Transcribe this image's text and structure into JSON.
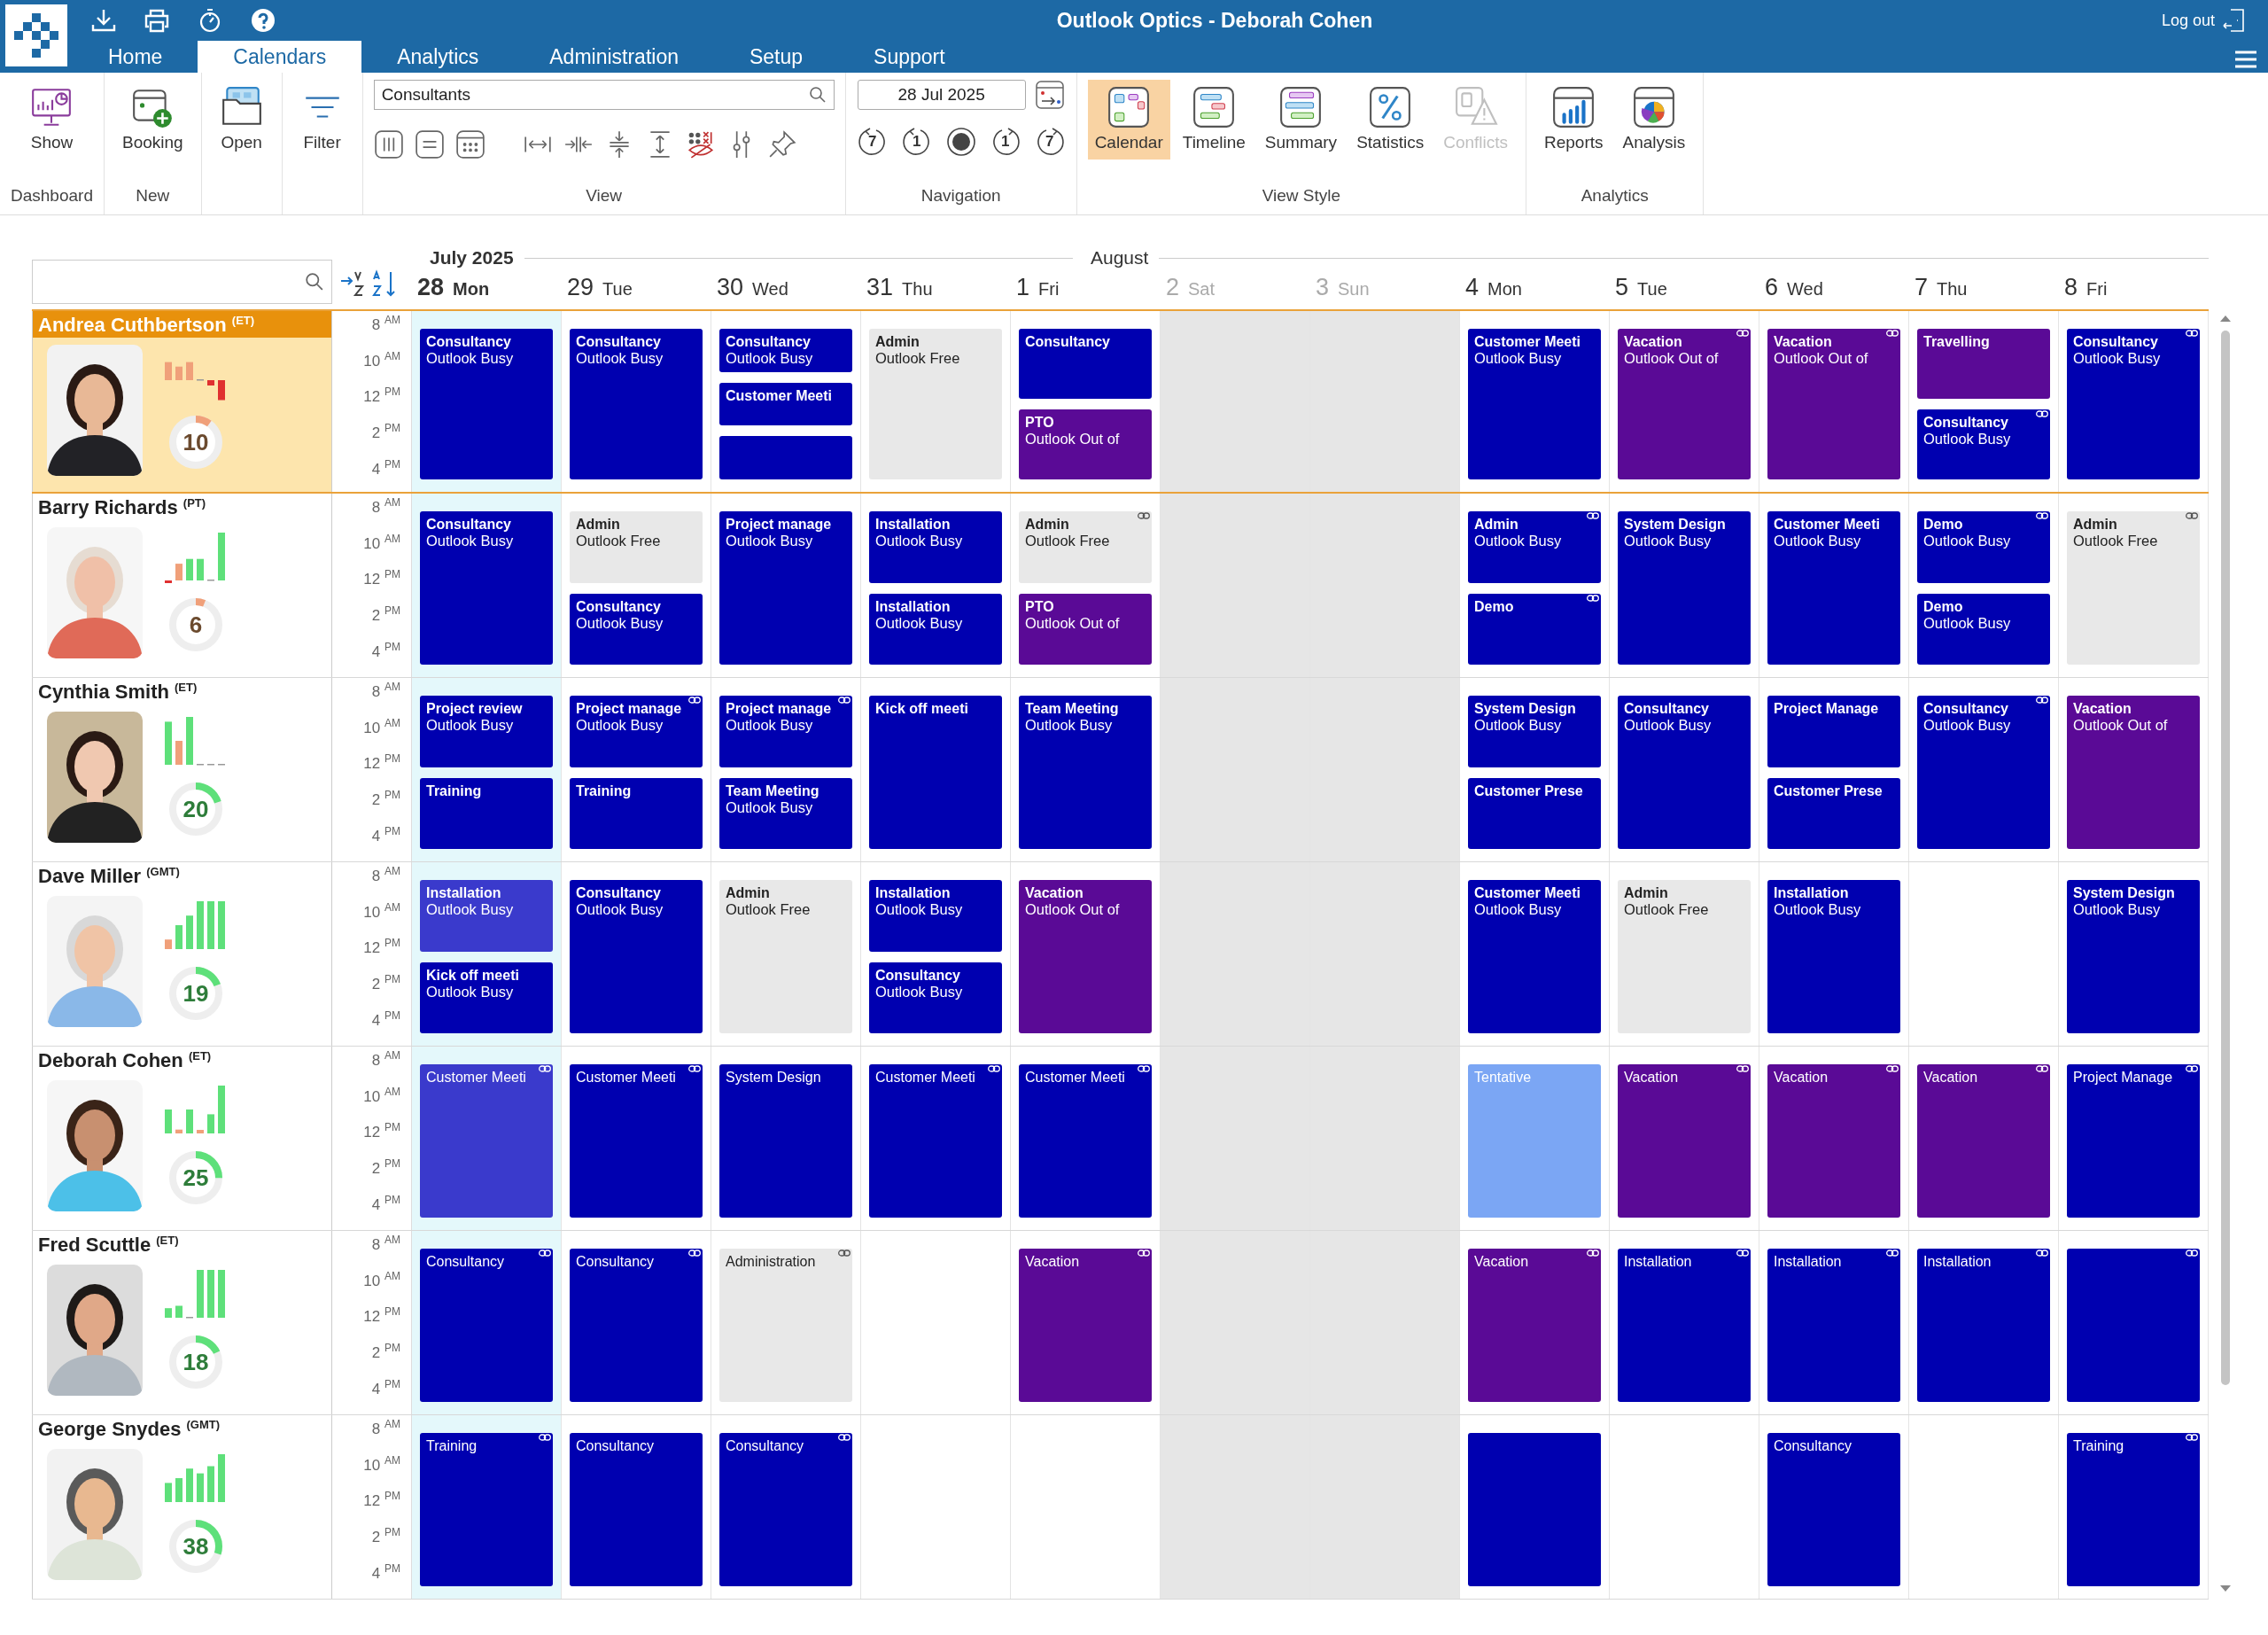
{
  "window": {
    "title": "Outlook Optics - Deborah Cohen",
    "logout": "Log out"
  },
  "tabs": [
    {
      "label": "Home",
      "selected": false
    },
    {
      "label": "Calendars",
      "selected": true
    },
    {
      "label": "Analytics",
      "selected": false
    },
    {
      "label": "Administration",
      "selected": false
    },
    {
      "label": "Setup",
      "selected": false
    },
    {
      "label": "Support",
      "selected": false
    }
  ],
  "ribbon": {
    "groups": [
      {
        "label": "Dashboard",
        "items": [
          {
            "kind": "dashboard",
            "label": "Show"
          }
        ]
      },
      {
        "label": "New",
        "items": [
          {
            "kind": "booking",
            "label": "Booking"
          }
        ]
      },
      {
        "items": [
          {
            "kind": "open",
            "label": "Open"
          }
        ]
      },
      {
        "items": [
          {
            "kind": "filter",
            "label": "Filter"
          }
        ]
      },
      {
        "label": "View",
        "search": {
          "value": "Consultants"
        },
        "tools": [
          {
            "kind": "columns"
          },
          {
            "kind": "rows"
          },
          {
            "kind": "grid"
          },
          {
            "kind": "widen"
          },
          {
            "kind": "narrow"
          },
          {
            "kind": "compress"
          },
          {
            "kind": "expand"
          },
          {
            "kind": "hide"
          },
          {
            "kind": "sliders"
          },
          {
            "kind": "pin"
          }
        ]
      },
      {
        "label": "Navigation",
        "date": {
          "value": "28 Jul 2025"
        },
        "nav": [
          {
            "kind": "back",
            "label": "7"
          },
          {
            "kind": "back",
            "label": "1"
          },
          {
            "kind": "today"
          },
          {
            "kind": "forward",
            "label": "1"
          },
          {
            "kind": "forward",
            "label": "7"
          }
        ]
      },
      {
        "label": "View Style",
        "items": [
          {
            "kind": "calendar",
            "label": "Calendar",
            "selected": true,
            "disabled": false
          },
          {
            "kind": "timeline",
            "label": "Timeline",
            "selected": false,
            "disabled": false
          },
          {
            "kind": "summary",
            "label": "Summary",
            "selected": false,
            "disabled": false
          },
          {
            "kind": "statistics",
            "label": "Statistics",
            "selected": false,
            "disabled": false
          },
          {
            "kind": "conflicts",
            "label": "Conflicts",
            "selected": false,
            "disabled": true
          }
        ]
      },
      {
        "label": "Analytics",
        "items": [
          {
            "kind": "reports",
            "label": "Reports"
          },
          {
            "kind": "analysis",
            "label": "Analysis"
          }
        ]
      }
    ]
  },
  "calendar": {
    "months": [
      {
        "label": "July 2025",
        "days": [
          {
            "number": "28",
            "weekday": "Mon",
            "today": true,
            "weekend": false
          },
          {
            "number": "29",
            "weekday": "Tue",
            "today": false,
            "weekend": false
          },
          {
            "number": "30",
            "weekday": "Wed",
            "today": false,
            "weekend": false
          },
          {
            "number": "31",
            "weekday": "Thu",
            "today": false,
            "weekend": false
          }
        ]
      },
      {
        "label": "August",
        "days": [
          {
            "number": "1",
            "weekday": "Fri",
            "today": false,
            "weekend": false
          },
          {
            "number": "2",
            "weekday": "Sat",
            "today": false,
            "weekend": true
          },
          {
            "number": "3",
            "weekday": "Sun",
            "today": false,
            "weekend": true
          },
          {
            "number": "4",
            "weekday": "Mon",
            "today": false,
            "weekend": false
          },
          {
            "number": "5",
            "weekday": "Tue",
            "today": false,
            "weekend": false
          },
          {
            "number": "6",
            "weekday": "Wed",
            "today": false,
            "weekend": false
          },
          {
            "number": "7",
            "weekday": "Thu",
            "today": false,
            "weekend": false
          },
          {
            "number": "8",
            "weekday": "Fri",
            "today": false,
            "weekend": false
          }
        ]
      }
    ]
  },
  "people": [
    {
      "name": "Andrea Cuthbertson $^{(ET)}$",
      "selected": true,
      "score": {
        "value": "10",
        "level": 0.1,
        "kind": "low"
      },
      "hours": [
        "8 $^{AM}$",
        "10 $^{AM}$",
        "12 $^{PM}$",
        "2 $^{PM}$",
        "4 $^{PM}$"
      ],
      "days": [
        {
          "today": true,
          "weekend": false,
          "events": [
            {
              "title": "Consultancy",
              "status": "Outlook Busy",
              "color": "#0000b0",
              "kind": "outlook",
              "linked": false
            }
          ]
        },
        {
          "today": false,
          "weekend": false,
          "events": [
            {
              "title": "Consultancy",
              "status": "Outlook Busy",
              "color": "#0000b0",
              "kind": "outlook",
              "linked": false
            }
          ]
        },
        {
          "today": false,
          "weekend": false,
          "events": [
            {
              "title": "Consultancy",
              "status": "Outlook Busy",
              "color": "#0000b0",
              "kind": "outlook",
              "linked": false
            },
            {
              "title": "Customer Meeti",
              "color": "#0000b0",
              "kind": "outlook",
              "linked": false
            },
            {
              "color": "#0000b0",
              "kind": "outlook",
              "linked": false
            }
          ]
        },
        {
          "today": false,
          "weekend": false,
          "events": [
            {
              "title": "Admin",
              "status": "Outlook Free",
              "color": "#e8e8e8",
              "kind": "outlook",
              "linked": false
            }
          ]
        },
        {
          "today": false,
          "weekend": false,
          "events": [
            {
              "title": "Consultancy",
              "color": "#0000b0",
              "kind": "outlook",
              "linked": false
            },
            {
              "title": "PTO",
              "status": "Outlook Out of",
              "color": "#5a0a96",
              "kind": "outlook",
              "linked": false
            }
          ]
        },
        {
          "today": false,
          "weekend": true
        },
        {
          "today": false,
          "weekend": true
        },
        {
          "today": false,
          "weekend": false,
          "events": [
            {
              "title": "Customer Meeti",
              "status": "Outlook Busy",
              "color": "#0000b0",
              "kind": "outlook",
              "linked": false
            }
          ]
        },
        {
          "today": false,
          "weekend": false,
          "events": [
            {
              "title": "Vacation",
              "status": "Outlook Out of",
              "color": "#5a0a96",
              "kind": "outlook",
              "linked": true
            }
          ]
        },
        {
          "today": false,
          "weekend": false,
          "events": [
            {
              "title": "Vacation",
              "status": "Outlook Out of",
              "color": "#5a0a96",
              "kind": "outlook",
              "linked": true
            }
          ]
        },
        {
          "today": false,
          "weekend": false,
          "events": [
            {
              "title": "Travelling",
              "color": "#5a0a96",
              "kind": "outlook",
              "linked": false
            },
            {
              "title": "Consultancy",
              "status": "Outlook Busy",
              "color": "#0000b0",
              "kind": "outlook",
              "linked": true
            }
          ]
        },
        {
          "today": false,
          "weekend": false,
          "events": [
            {
              "title": "Consultancy",
              "status": "Outlook Busy",
              "color": "#0000b0",
              "kind": "outlook",
              "linked": true
            }
          ]
        }
      ]
    },
    {
      "name": "Barry Richards $^{(PT)}$",
      "selected": false,
      "score": {
        "value": "6",
        "level": 0.06,
        "kind": "low"
      },
      "hours": [
        "8 $^{AM}$",
        "10 $^{AM}$",
        "12 $^{PM}$",
        "2 $^{PM}$",
        "4 $^{PM}$"
      ],
      "days": [
        {
          "today": true,
          "weekend": false,
          "events": [
            {
              "title": "Consultancy",
              "status": "Outlook Busy",
              "color": "#0000b0",
              "kind": "outlook",
              "linked": false
            }
          ]
        },
        {
          "today": false,
          "weekend": false,
          "events": [
            {
              "title": "Admin",
              "status": "Outlook Free",
              "color": "#e8e8e8",
              "kind": "outlook",
              "linked": false
            },
            {
              "title": "Consultancy",
              "status": "Outlook Busy",
              "color": "#0000b0",
              "kind": "outlook",
              "linked": false
            }
          ]
        },
        {
          "today": false,
          "weekend": false,
          "events": [
            {
              "title": "Project manage",
              "status": "Outlook Busy",
              "color": "#0000b0",
              "kind": "outlook",
              "linked": false
            }
          ]
        },
        {
          "today": false,
          "weekend": false,
          "events": [
            {
              "title": "Installation",
              "status": "Outlook Busy",
              "color": "#0000b0",
              "kind": "outlook",
              "linked": false
            },
            {
              "title": "Installation",
              "status": "Outlook Busy",
              "color": "#0000b0",
              "kind": "outlook",
              "linked": false
            }
          ]
        },
        {
          "today": false,
          "weekend": false,
          "events": [
            {
              "title": "Admin",
              "status": "Outlook Free",
              "color": "#e8e8e8",
              "kind": "outlook",
              "linked": true
            },
            {
              "title": "PTO",
              "status": "Outlook Out of",
              "color": "#5a0a96",
              "kind": "outlook",
              "linked": false
            }
          ]
        },
        {
          "today": false,
          "weekend": true
        },
        {
          "today": false,
          "weekend": true
        },
        {
          "today": false,
          "weekend": false,
          "events": [
            {
              "title": "Admin",
              "status": "Outlook Busy",
              "color": "#0000b0",
              "kind": "outlook",
              "linked": true
            },
            {
              "title": "Demo",
              "color": "#0000b0",
              "kind": "outlook",
              "linked": true
            }
          ]
        },
        {
          "today": false,
          "weekend": false,
          "events": [
            {
              "title": "System Design",
              "status": "Outlook Busy",
              "color": "#0000b0",
              "kind": "outlook",
              "linked": false
            }
          ]
        },
        {
          "today": false,
          "weekend": false,
          "events": [
            {
              "title": "Customer Meeti",
              "status": "Outlook Busy",
              "color": "#0000b0",
              "kind": "outlook",
              "linked": false
            }
          ]
        },
        {
          "today": false,
          "weekend": false,
          "events": [
            {
              "title": "Demo",
              "status": "Outlook Busy",
              "color": "#0000b0",
              "kind": "outlook",
              "linked": true
            },
            {
              "title": "Demo",
              "status": "Outlook Busy",
              "color": "#0000b0",
              "kind": "outlook",
              "linked": false
            }
          ]
        },
        {
          "today": false,
          "weekend": false,
          "events": [
            {
              "title": "Admin",
              "status": "Outlook Free",
              "color": "#e8e8e8",
              "kind": "outlook",
              "linked": true
            }
          ]
        }
      ]
    },
    {
      "name": "Cynthia Smith $^{(ET)}$",
      "selected": false,
      "score": {
        "value": "20",
        "level": 0.2,
        "kind": "high"
      },
      "hours": [
        "8 $^{AM}$",
        "10 $^{AM}$",
        "12 $^{PM}$",
        "2 $^{PM}$",
        "4 $^{PM}$"
      ],
      "days": [
        {
          "today": true,
          "weekend": false,
          "events": [
            {
              "title": "Project review",
              "status": "Outlook Busy",
              "color": "#0000b0",
              "kind": "outlook",
              "linked": false
            },
            {
              "title": "Training",
              "color": "#0000b0",
              "kind": "outlook",
              "linked": false
            }
          ]
        },
        {
          "today": false,
          "weekend": false,
          "events": [
            {
              "title": "Project manage",
              "status": "Outlook Busy",
              "color": "#0000b0",
              "kind": "outlook",
              "linked": true
            },
            {
              "title": "Training",
              "color": "#0000b0",
              "kind": "outlook",
              "linked": false
            }
          ]
        },
        {
          "today": false,
          "weekend": false,
          "events": [
            {
              "title": "Project manage",
              "status": "Outlook Busy",
              "color": "#0000b0",
              "kind": "outlook",
              "linked": true
            },
            {
              "title": "Team Meeting",
              "status": "Outlook Busy",
              "color": "#0000b0",
              "kind": "outlook",
              "linked": false
            }
          ]
        },
        {
          "today": false,
          "weekend": false,
          "events": [
            {
              "title": "Kick off meeti",
              "color": "#0000b0",
              "kind": "outlook",
              "linked": false
            }
          ]
        },
        {
          "today": false,
          "weekend": false,
          "events": [
            {
              "title": "Team Meeting",
              "status": "Outlook Busy",
              "color": "#0000b0",
              "kind": "outlook",
              "linked": false
            }
          ]
        },
        {
          "today": false,
          "weekend": true
        },
        {
          "today": false,
          "weekend": true
        },
        {
          "today": false,
          "weekend": false,
          "events": [
            {
              "title": "System Design",
              "status": "Outlook Busy",
              "color": "#0000b0",
              "kind": "outlook",
              "linked": false
            },
            {
              "title": "Customer Prese",
              "color": "#0000b0",
              "kind": "outlook",
              "linked": false
            }
          ]
        },
        {
          "today": false,
          "weekend": false,
          "events": [
            {
              "title": "Consultancy",
              "status": "Outlook Busy",
              "color": "#0000b0",
              "kind": "outlook",
              "linked": false
            }
          ]
        },
        {
          "today": false,
          "weekend": false,
          "events": [
            {
              "title": "Project Manage",
              "color": "#0000b0",
              "kind": "outlook",
              "linked": false
            },
            {
              "title": "Customer Prese",
              "color": "#0000b0",
              "kind": "outlook",
              "linked": false
            }
          ]
        },
        {
          "today": false,
          "weekend": false,
          "events": [
            {
              "title": "Consultancy",
              "status": "Outlook Busy",
              "color": "#0000b0",
              "kind": "outlook",
              "linked": true
            }
          ]
        },
        {
          "today": false,
          "weekend": false,
          "events": [
            {
              "title": "Vacation",
              "status": "Outlook Out of",
              "color": "#5a0a96",
              "kind": "outlook",
              "linked": false
            }
          ]
        }
      ]
    },
    {
      "name": "Dave Miller $^{(GMT)}$",
      "selected": false,
      "score": {
        "value": "19",
        "level": 0.19,
        "kind": "high"
      },
      "hours": [
        "8 $^{AM}$",
        "10 $^{AM}$",
        "12 $^{PM}$",
        "2 $^{PM}$",
        "4 $^{PM}$"
      ],
      "days": [
        {
          "today": true,
          "weekend": false,
          "events": [
            {
              "title": "Installation",
              "status": "Outlook Busy",
              "color": "#3a3acc",
              "kind": "outlook",
              "linked": false
            },
            {
              "title": "Kick off meeti",
              "status": "Outlook Busy",
              "color": "#0000b0",
              "kind": "outlook",
              "linked": false
            }
          ]
        },
        {
          "today": false,
          "weekend": false,
          "events": [
            {
              "title": "Consultancy",
              "status": "Outlook Busy",
              "color": "#0000b0",
              "kind": "outlook",
              "linked": false
            }
          ]
        },
        {
          "today": false,
          "weekend": false,
          "events": [
            {
              "title": "Admin",
              "status": "Outlook Free",
              "color": "#e8e8e8",
              "kind": "outlook",
              "linked": false
            }
          ]
        },
        {
          "today": false,
          "weekend": false,
          "events": [
            {
              "title": "Installation",
              "status": "Outlook Busy",
              "color": "#0000b0",
              "kind": "outlook",
              "linked": false
            },
            {
              "title": "Consultancy",
              "status": "Outlook Busy",
              "color": "#0000b0",
              "kind": "outlook",
              "linked": false
            }
          ]
        },
        {
          "today": false,
          "weekend": false,
          "events": [
            {
              "title": "Vacation",
              "status": "Outlook Out of",
              "color": "#5a0a96",
              "kind": "outlook",
              "linked": false
            }
          ]
        },
        {
          "today": false,
          "weekend": true
        },
        {
          "today": false,
          "weekend": true
        },
        {
          "today": false,
          "weekend": false,
          "events": [
            {
              "title": "Customer Meeti",
              "status": "Outlook Busy",
              "color": "#0000b0",
              "kind": "outlook",
              "linked": false
            }
          ]
        },
        {
          "today": false,
          "weekend": false,
          "events": [
            {
              "title": "Admin",
              "status": "Outlook Free",
              "color": "#e8e8e8",
              "kind": "outlook",
              "linked": false
            }
          ]
        },
        {
          "today": false,
          "weekend": false,
          "events": [
            {
              "title": "Installation",
              "status": "Outlook Busy",
              "color": "#0000b0",
              "kind": "outlook",
              "linked": false
            }
          ]
        },
        {
          "today": false,
          "weekend": false
        },
        {
          "today": false,
          "weekend": false,
          "events": [
            {
              "title": "System Design",
              "status": "Outlook Busy",
              "color": "#0000b0",
              "kind": "outlook",
              "linked": false
            }
          ]
        }
      ]
    },
    {
      "name": "Deborah Cohen $^{(ET)}$",
      "selected": false,
      "score": {
        "value": "25",
        "level": 0.25,
        "kind": "high"
      },
      "hours": [
        "8 $^{AM}$",
        "10 $^{AM}$",
        "12 $^{PM}$",
        "2 $^{PM}$",
        "4 $^{PM}$"
      ],
      "days": [
        {
          "today": true,
          "weekend": false,
          "events": [
            {
              "title": "Customer Meeti",
              "color": "#3a3acc",
              "kind": "native",
              "linked": true
            }
          ]
        },
        {
          "today": false,
          "weekend": false,
          "events": [
            {
              "title": "Customer Meeti",
              "color": "#0000b0",
              "kind": "native",
              "linked": true
            }
          ]
        },
        {
          "today": false,
          "weekend": false,
          "events": [
            {
              "title": "System Design",
              "color": "#0000b0",
              "kind": "native",
              "linked": false
            }
          ]
        },
        {
          "today": false,
          "weekend": false,
          "events": [
            {
              "title": "Customer Meeti",
              "color": "#0000b0",
              "kind": "native",
              "linked": true
            }
          ]
        },
        {
          "today": false,
          "weekend": false,
          "events": [
            {
              "title": "Customer Meeti",
              "color": "#0000b0",
              "kind": "native",
              "linked": true
            }
          ]
        },
        {
          "today": false,
          "weekend": true
        },
        {
          "today": false,
          "weekend": true
        },
        {
          "today": false,
          "weekend": false,
          "events": [
            {
              "title": "Tentative",
              "color": "#7ba6f4",
              "kind": "native",
              "linked": false
            }
          ]
        },
        {
          "today": false,
          "weekend": false,
          "events": [
            {
              "title": "Vacation",
              "color": "#5a0a96",
              "kind": "native",
              "linked": true
            }
          ]
        },
        {
          "today": false,
          "weekend": false,
          "events": [
            {
              "title": "Vacation",
              "color": "#5a0a96",
              "kind": "native",
              "linked": true
            }
          ]
        },
        {
          "today": false,
          "weekend": false,
          "events": [
            {
              "title": "Vacation",
              "color": "#5a0a96",
              "kind": "native",
              "linked": true
            }
          ]
        },
        {
          "today": false,
          "weekend": false,
          "events": [
            {
              "title": "Project Manage",
              "color": "#0000b0",
              "kind": "native",
              "linked": true
            }
          ]
        }
      ]
    },
    {
      "name": "Fred Scuttle $^{(ET)}$",
      "selected": false,
      "score": {
        "value": "18",
        "level": 0.18,
        "kind": "high"
      },
      "hours": [
        "8 $^{AM}$",
        "10 $^{AM}$",
        "12 $^{PM}$",
        "2 $^{PM}$",
        "4 $^{PM}$"
      ],
      "days": [
        {
          "today": true,
          "weekend": false,
          "events": [
            {
              "title": "Consultancy",
              "color": "#0000b0",
              "kind": "native",
              "linked": true
            }
          ]
        },
        {
          "today": false,
          "weekend": false,
          "events": [
            {
              "title": "Consultancy",
              "color": "#0000b0",
              "kind": "native",
              "linked": true
            }
          ]
        },
        {
          "today": false,
          "weekend": false,
          "events": [
            {
              "title": "Administration",
              "color": "#e8e8e8",
              "kind": "native",
              "linked": true
            }
          ]
        },
        {
          "today": false,
          "weekend": false
        },
        {
          "today": false,
          "weekend": false,
          "events": [
            {
              "title": "Vacation",
              "color": "#5a0a96",
              "kind": "native",
              "linked": true
            }
          ]
        },
        {
          "today": false,
          "weekend": true
        },
        {
          "today": false,
          "weekend": true
        },
        {
          "today": false,
          "weekend": false,
          "events": [
            {
              "title": "Vacation",
              "color": "#5a0a96",
              "kind": "native",
              "linked": true
            }
          ]
        },
        {
          "today": false,
          "weekend": false,
          "events": [
            {
              "title": "Installation",
              "color": "#0000b0",
              "kind": "native",
              "linked": true
            }
          ]
        },
        {
          "today": false,
          "weekend": false,
          "events": [
            {
              "title": "Installation",
              "color": "#0000b0",
              "kind": "native",
              "linked": true
            }
          ]
        },
        {
          "today": false,
          "weekend": false,
          "events": [
            {
              "title": "Installation",
              "color": "#0000b0",
              "kind": "native",
              "linked": true
            }
          ]
        },
        {
          "today": false,
          "weekend": false,
          "events": [
            {
              "color": "#0000b0",
              "kind": "native",
              "linked": true
            }
          ]
        }
      ]
    },
    {
      "name": "George Snydes $^{(GMT)}$",
      "selected": false,
      "score": {
        "value": "38",
        "level": 0.3,
        "kind": "high"
      },
      "hours": [
        "8 $^{AM}$",
        "10 $^{AM}$",
        "12 $^{PM}$",
        "2 $^{PM}$",
        "4 $^{PM}$"
      ],
      "days": [
        {
          "today": true,
          "weekend": false,
          "events": [
            {
              "title": "Training",
              "color": "#0000b0",
              "kind": "native",
              "linked": true
            }
          ]
        },
        {
          "today": false,
          "weekend": false,
          "events": [
            {
              "title": "Consultancy",
              "color": "#0000b0",
              "kind": "native",
              "linked": false
            }
          ]
        },
        {
          "today": false,
          "weekend": false,
          "events": [
            {
              "title": "Consultancy",
              "color": "#0000b0",
              "kind": "native",
              "linked": true
            }
          ]
        },
        {
          "today": false,
          "weekend": false
        },
        {
          "today": false,
          "weekend": false
        },
        {
          "today": false,
          "weekend": true
        },
        {
          "today": false,
          "weekend": true
        },
        {
          "today": false,
          "weekend": false,
          "events": [
            {
              "color": "#0000b0",
              "kind": "native",
              "linked": false
            }
          ]
        },
        {
          "today": false,
          "weekend": false
        },
        {
          "today": false,
          "weekend": false,
          "events": [
            {
              "title": "Consultancy",
              "color": "#0000b0",
              "kind": "native",
              "linked": false
            }
          ]
        },
        {
          "today": false,
          "weekend": false
        },
        {
          "today": false,
          "weekend": false,
          "events": [
            {
              "title": "Training",
              "color": "#0000b0",
              "kind": "native",
              "linked": true
            }
          ]
        }
      ]
    }
  ]
}
